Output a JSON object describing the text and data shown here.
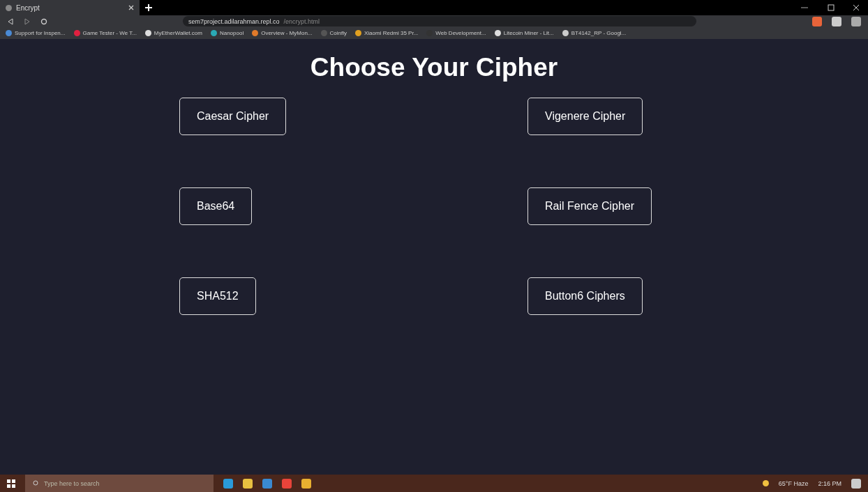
{
  "browser": {
    "tab": {
      "title": "Encrypt",
      "selected": true
    },
    "url": {
      "host": "sem7project.adilarahman.repl.co",
      "path": "/encrypt.html"
    },
    "bookmarks": [
      {
        "label": "Support for Inspen..."
      },
      {
        "label": "Game Tester - We T..."
      },
      {
        "label": "MyEtherWallet.com"
      },
      {
        "label": "Nanopool"
      },
      {
        "label": "Overview - MyMon..."
      },
      {
        "label": "Coinfly"
      },
      {
        "label": "Xiaomi Redmi 35 Pr..."
      },
      {
        "label": "Web Development..."
      },
      {
        "label": "Litecoin Miner - Lit..."
      },
      {
        "label": "BT4142_RP - Googl..."
      }
    ]
  },
  "page": {
    "title": "Choose Your Cipher",
    "buttons": [
      {
        "label": "Caesar Cipher"
      },
      {
        "label": "Vigenere Cipher"
      },
      {
        "label": "Base64"
      },
      {
        "label": "Rail Fence Cipher"
      },
      {
        "label": "SHA512"
      },
      {
        "label": "Button6 Ciphers"
      }
    ]
  },
  "taskbar": {
    "search": {
      "placeholder": "Type here to search"
    },
    "weather": "65°F Haze",
    "time": "2:16 PM"
  }
}
